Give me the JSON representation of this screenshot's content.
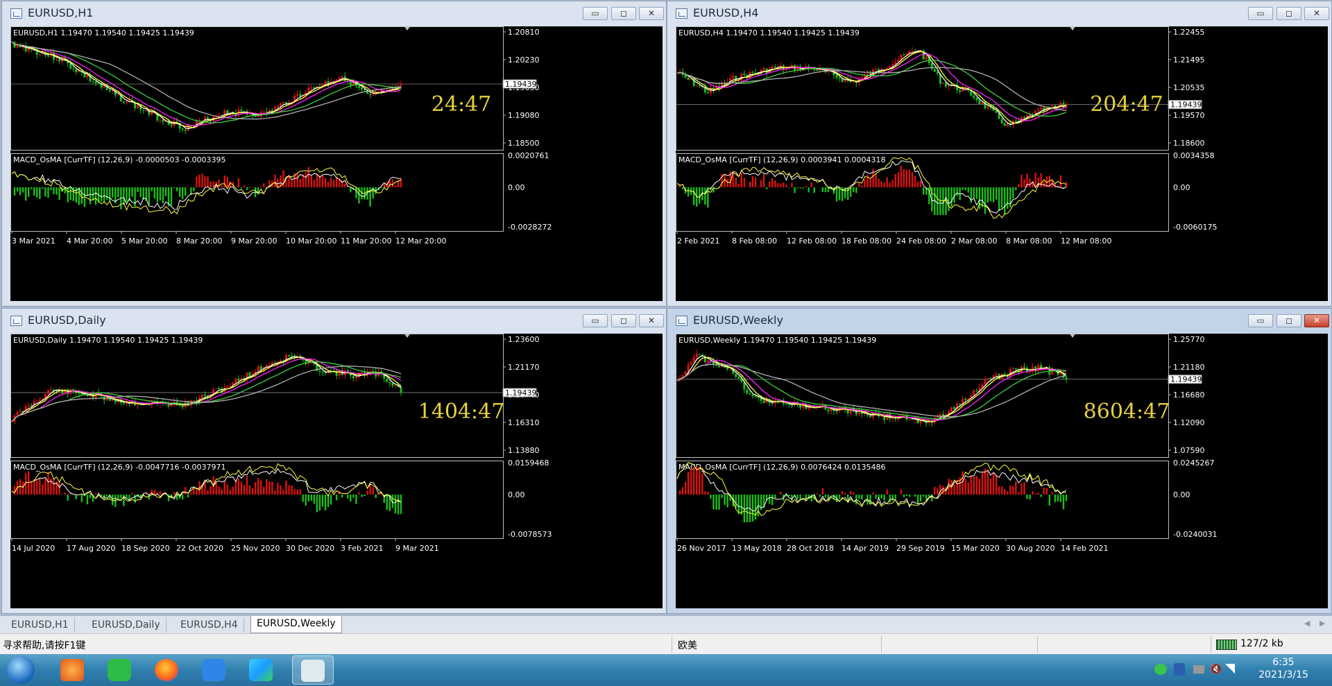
{
  "windows": [
    {
      "id": "h1",
      "title": "EURUSD,H1",
      "header": "EURUSD,H1  1.19470 1.19540 1.19425 1.19439",
      "price_axis": [
        "1.20810",
        "1.20230",
        "1.19650",
        "1.19080",
        "1.18500"
      ],
      "current_price": "1.19439",
      "timer": "24:47",
      "macd_label": "MACD_OsMA [CurrTF] (12,26,9) -0.0000503 -0.0003395",
      "macd_axis": [
        "0.0020761",
        "0.00",
        "-0.0028272"
      ],
      "time_axis": [
        "3 Mar 2021",
        "4 Mar 20:00",
        "5 Mar 20:00",
        "8 Mar 20:00",
        "9 Mar 20:00",
        "10 Mar 20:00",
        "11 Mar 20:00",
        "12 Mar 20:00"
      ]
    },
    {
      "id": "h4",
      "title": "EURUSD,H4",
      "header": "EURUSD,H4  1.19470 1.19540 1.19425 1.19439",
      "price_axis": [
        "1.22455",
        "1.21495",
        "1.20535",
        "1.19570",
        "1.18600"
      ],
      "current_price": "1.19439",
      "timer": "204:47",
      "macd_label": "MACD_OsMA [CurrTF] (12,26,9) 0.0003941 0.0004318",
      "macd_axis": [
        "0.0034358",
        "0.00",
        "-0.0060175"
      ],
      "time_axis": [
        "2 Feb 2021",
        "8 Feb 08:00",
        "12 Feb 08:00",
        "18 Feb 08:00",
        "24 Feb 08:00",
        "2 Mar 08:00",
        "8 Mar 08:00",
        "12 Mar 08:00"
      ]
    },
    {
      "id": "daily",
      "title": "EURUSD,Daily",
      "header": "EURUSD,Daily  1.19470 1.19540 1.19425 1.19439",
      "price_axis": [
        "1.23600",
        "1.21170",
        "1.18740",
        "1.16310",
        "1.13880"
      ],
      "current_price": "1.19439",
      "timer": "1404:47",
      "macd_label": "MACD_OsMA [CurrTF] (12,26,9) -0.0047716 -0.0037971",
      "macd_axis": [
        "0.0159468",
        "0.00",
        "-0.0078573"
      ],
      "time_axis": [
        "14 Jul 2020",
        "17 Aug 2020",
        "18 Sep 2020",
        "22 Oct 2020",
        "25 Nov 2020",
        "30 Dec 2020",
        "3 Feb 2021",
        "9 Mar 2021"
      ]
    },
    {
      "id": "weekly",
      "title": "EURUSD,Weekly",
      "header": "EURUSD,Weekly  1.19470 1.19540 1.19425 1.19439",
      "price_axis": [
        "1.25770",
        "1.21180",
        "1.16680",
        "1.12090",
        "1.07590"
      ],
      "current_price": "1.19439",
      "timer": "8604:47",
      "macd_label": "MACD_OsMA [CurrTF] (12,26,9) 0.0076424 0.0135486",
      "macd_axis": [
        "0.0245267",
        "0.00",
        "-0.0240031"
      ],
      "time_axis": [
        "26 Nov 2017",
        "13 May 2018",
        "28 Oct 2018",
        "14 Apr 2019",
        "29 Sep 2019",
        "15 Mar 2020",
        "30 Aug 2020",
        "14 Feb 2021"
      ]
    }
  ],
  "window_buttons": {
    "min": "▭",
    "max": "◻",
    "close": "✕"
  },
  "tabs": [
    "EURUSD,H1",
    "EURUSD,Daily",
    "EURUSD,H4",
    "EURUSD,Weekly"
  ],
  "active_tab": "EURUSD,Weekly",
  "status": {
    "help": "寻求帮助,请按F1键",
    "profile": "欧美",
    "traffic": "127/2 kb"
  },
  "clock": {
    "time": "6:35",
    "date": "2021/3/15"
  },
  "colors": {
    "bull": "#e01010",
    "bear": "#18c018",
    "ma_white": "#ffffff",
    "ma_yellow": "#ffff40",
    "ma_magenta": "#ff20ff",
    "ma_green": "#40d040",
    "ma_gray": "#b0b0b0",
    "timer": "#e6d23c"
  }
}
